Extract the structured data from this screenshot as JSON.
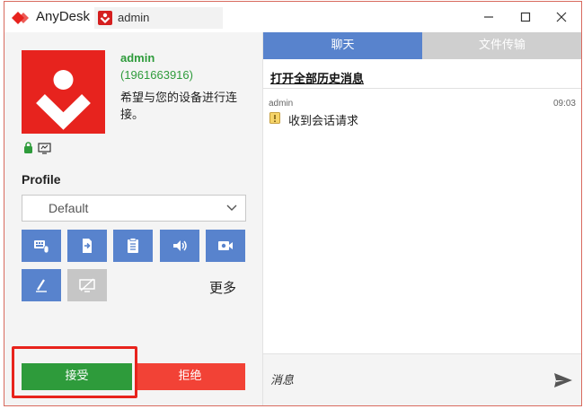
{
  "titlebar": {
    "app_title": "AnyDesk",
    "address": "admin",
    "icons": [
      "anydesk-logo-icon",
      "anydesk-small-icon",
      "minimize-icon",
      "maximize-icon",
      "close-icon"
    ],
    "brand_color": "#e7231e"
  },
  "user": {
    "name": "admin",
    "id": "(1961663916)",
    "request_message": "希望与您的设备进行连接。",
    "name_color": "#2e9b3b"
  },
  "profile": {
    "label": "Profile",
    "selected": "Default"
  },
  "permissions": {
    "buttons": [
      {
        "icon": "keyboard-mouse-icon",
        "enabled": true
      },
      {
        "icon": "file-transfer-icon",
        "enabled": true
      },
      {
        "icon": "clipboard-icon",
        "enabled": true
      },
      {
        "icon": "audio-icon",
        "enabled": true
      },
      {
        "icon": "record-session-icon",
        "enabled": true
      },
      {
        "icon": "draw-icon",
        "enabled": true
      },
      {
        "icon": "screen-privacy-icon",
        "enabled": false
      }
    ],
    "more_label": "更多",
    "accent_color": "#5883cd"
  },
  "actions": {
    "accept_label": "接受",
    "reject_label": "拒绝",
    "accept_color": "#2e9b3b",
    "reject_color": "#f24236"
  },
  "chat": {
    "tabs": [
      {
        "label": "聊天",
        "active": true
      },
      {
        "label": "文件传输",
        "active": false
      }
    ],
    "history_link": "打开全部历史消息",
    "messages": [
      {
        "sender": "admin",
        "time": "09:03",
        "text": "收到会话请求",
        "icon": "session-request-icon"
      }
    ],
    "input_placeholder": "消息",
    "send_icon": "send-icon"
  }
}
